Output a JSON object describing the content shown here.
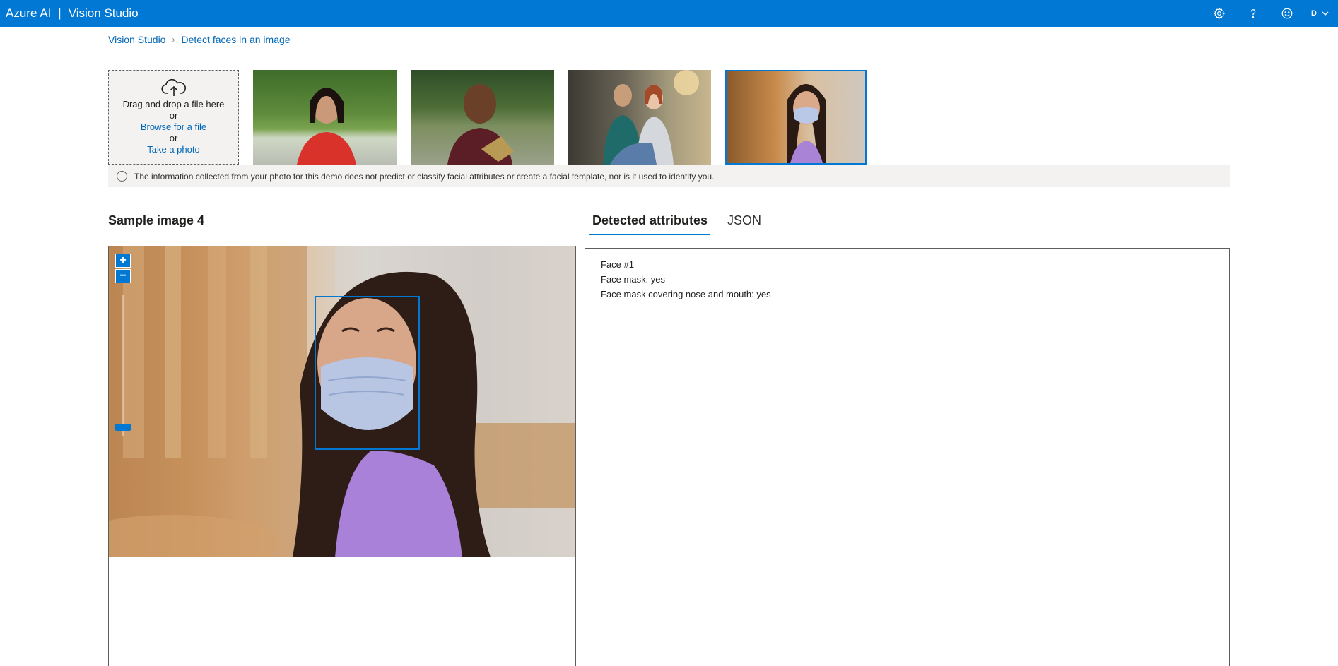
{
  "header": {
    "brand": "Azure AI",
    "separator": "|",
    "product": "Vision Studio",
    "user_initial": "D",
    "icons": [
      "gear-icon",
      "help-icon",
      "feedback-smiley-icon",
      "chevron-down-icon"
    ]
  },
  "breadcrumb": {
    "root": "Vision Studio",
    "current": "Detect faces in an image"
  },
  "upload": {
    "drag_text": "Drag and drop a file here",
    "or1": "or",
    "browse_label": "Browse for a file",
    "or2": "or",
    "photo_label": "Take a photo",
    "icon": "cloud-upload-icon"
  },
  "samples": {
    "selected_index": 4,
    "count": 4
  },
  "info_bar": {
    "text": "The information collected from your photo for this demo does not predict or classify facial attributes or create a facial template, nor is it used to identify you.",
    "icon": "info-icon"
  },
  "image_section": {
    "title": "Sample image 4",
    "zoom_in": "+",
    "zoom_out": "−"
  },
  "tabs": [
    {
      "label": "Detected attributes",
      "active": true
    },
    {
      "label": "JSON",
      "active": false
    }
  ],
  "attributes": {
    "lines": [
      "Face #1",
      "Face mask: yes",
      "Face mask covering nose and mouth: yes"
    ]
  },
  "colors": {
    "accent": "#0078d4",
    "link": "#0067b8",
    "info_bg": "#f3f2f1"
  }
}
